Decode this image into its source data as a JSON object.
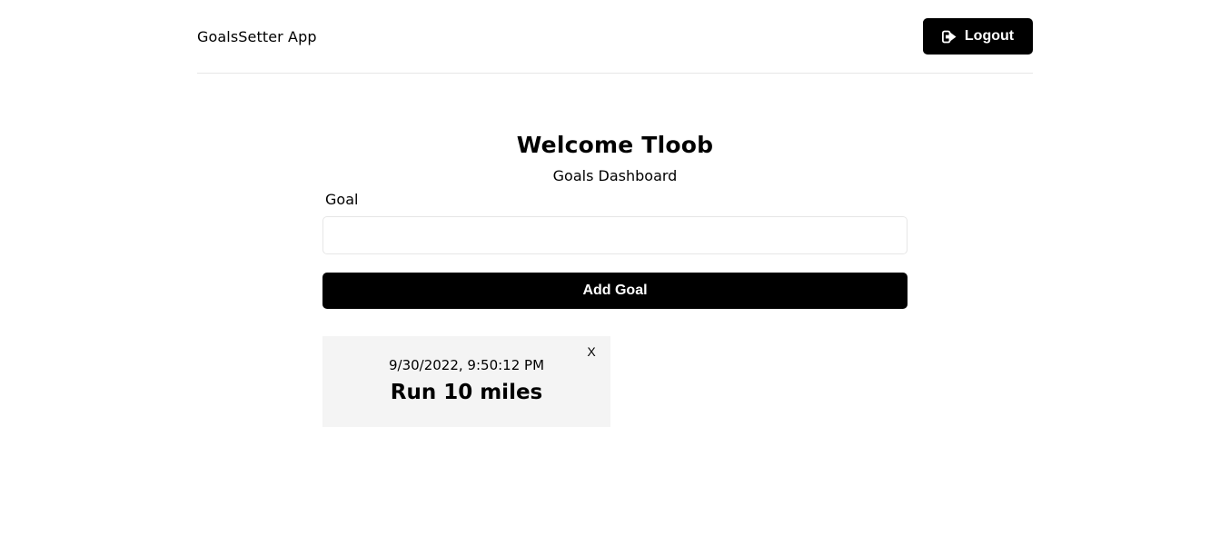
{
  "header": {
    "app_title": "GoalsSetter App",
    "logout_label": "Logout",
    "logout_icon": "sign-out-icon"
  },
  "heading": {
    "welcome": "Welcome Tloob",
    "subtitle": "Goals Dashboard"
  },
  "form": {
    "goal_label": "Goal",
    "goal_value": "",
    "goal_placeholder": "",
    "submit_label": "Add Goal"
  },
  "goals": [
    {
      "created_at": "9/30/2022, 9:50:12 PM",
      "text": "Run 10 miles",
      "delete_label": "X"
    }
  ],
  "colors": {
    "button_bg": "#000000",
    "button_text": "#ffffff",
    "card_bg": "#f4f4f4",
    "divider": "#e6e6e6"
  }
}
